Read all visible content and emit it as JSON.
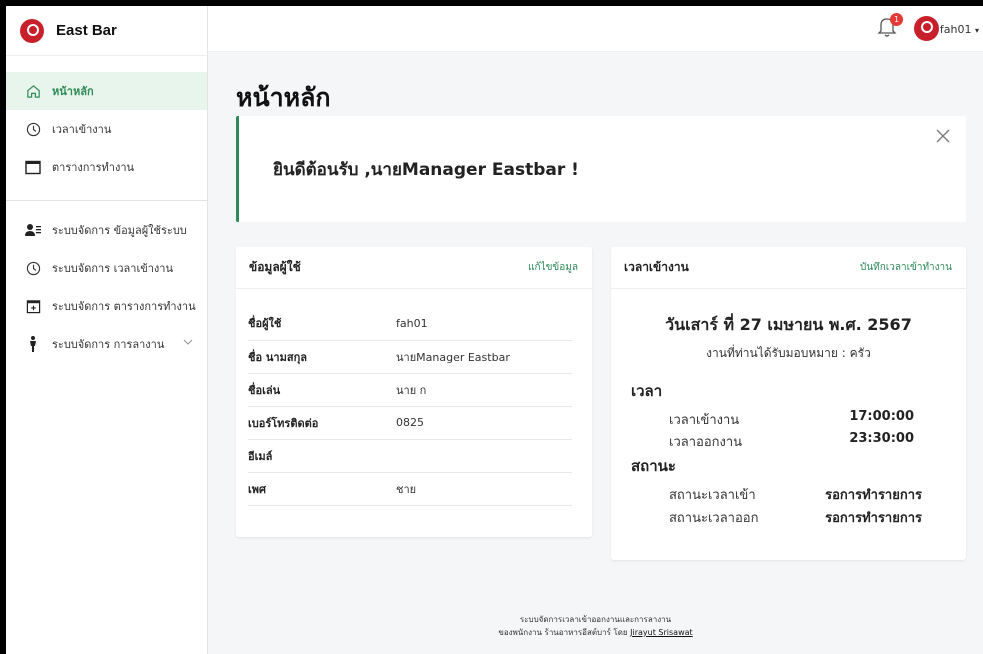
{
  "brand": {
    "name": "East Bar"
  },
  "sidebar": {
    "items": [
      {
        "label": "หน้าหลัก",
        "icon": "home-icon",
        "active": true
      },
      {
        "label": "เวลาเข้างาน",
        "icon": "clock-icon"
      },
      {
        "label": "ตารางการทำงาน",
        "icon": "calendar-icon"
      },
      {
        "label": "ระบบจัดการ ข้อมูลผู้ใช้ระบบ",
        "icon": "users-icon"
      },
      {
        "label": "ระบบจัดการ เวลาเข้างาน",
        "icon": "clock-icon"
      },
      {
        "label": "ระบบจัดการ ตารางการทำงาน",
        "icon": "calendar-plus-icon"
      },
      {
        "label": "ระบบจัดการ การลางาน",
        "icon": "person-walk-icon"
      }
    ]
  },
  "topbar": {
    "notification_count": "1",
    "username": "fah01"
  },
  "page": {
    "title": "หน้าหลัก"
  },
  "welcome": {
    "message": "ยินดีต้อนรับ ,นายManager Eastbar !"
  },
  "user_card": {
    "title": "ข้อมูลผู้ใช้",
    "edit_link": "แก้ไขข้อมูล",
    "rows": [
      {
        "label": "ชื่อผู้ใช้",
        "value": "fah01"
      },
      {
        "label": "ชื่อ นามสกุล",
        "value": "นายManager Eastbar"
      },
      {
        "label": "ชื่อเล่น",
        "value": "นาย ก"
      },
      {
        "label": "เบอร์โทรติดต่อ",
        "value": "0825"
      },
      {
        "label": "อีเมล์",
        "value": ""
      },
      {
        "label": "เพศ",
        "value": "ชาย"
      }
    ]
  },
  "time_card": {
    "title": "เวลาเข้างาน",
    "record_link": "บันทึกเวลาเข้าทำงาน",
    "date": "วันเสาร์ ที่ 27 เมษายน พ.ศ. 2567",
    "job": "งานที่ท่านได้รับมอบหมาย : ครัว",
    "time_heading": "เวลา",
    "checkin_label": "เวลาเข้างาน",
    "checkin_value": "17:00:00",
    "checkout_label": "เวลาออกงาน",
    "checkout_value": "23:30:00",
    "status_heading": "สถานะ",
    "status_in_label": "สถานะเวลาเข้า",
    "status_in_value": "รอการทำรายการ",
    "status_out_label": "สถานะเวลาออก",
    "status_out_value": "รอการทำรายการ"
  },
  "footer": {
    "line1": "ระบบจัดการเวลาเข้าออกงานและการลางาน",
    "line2_prefix": "ของพนักงาน ร้านอาหารอีสต์บาร์ โดย ",
    "author": "Jirayut Srisawat"
  },
  "colors": {
    "accent": "#2e8b57",
    "brand": "#c8202a",
    "badge": "#e53935"
  }
}
